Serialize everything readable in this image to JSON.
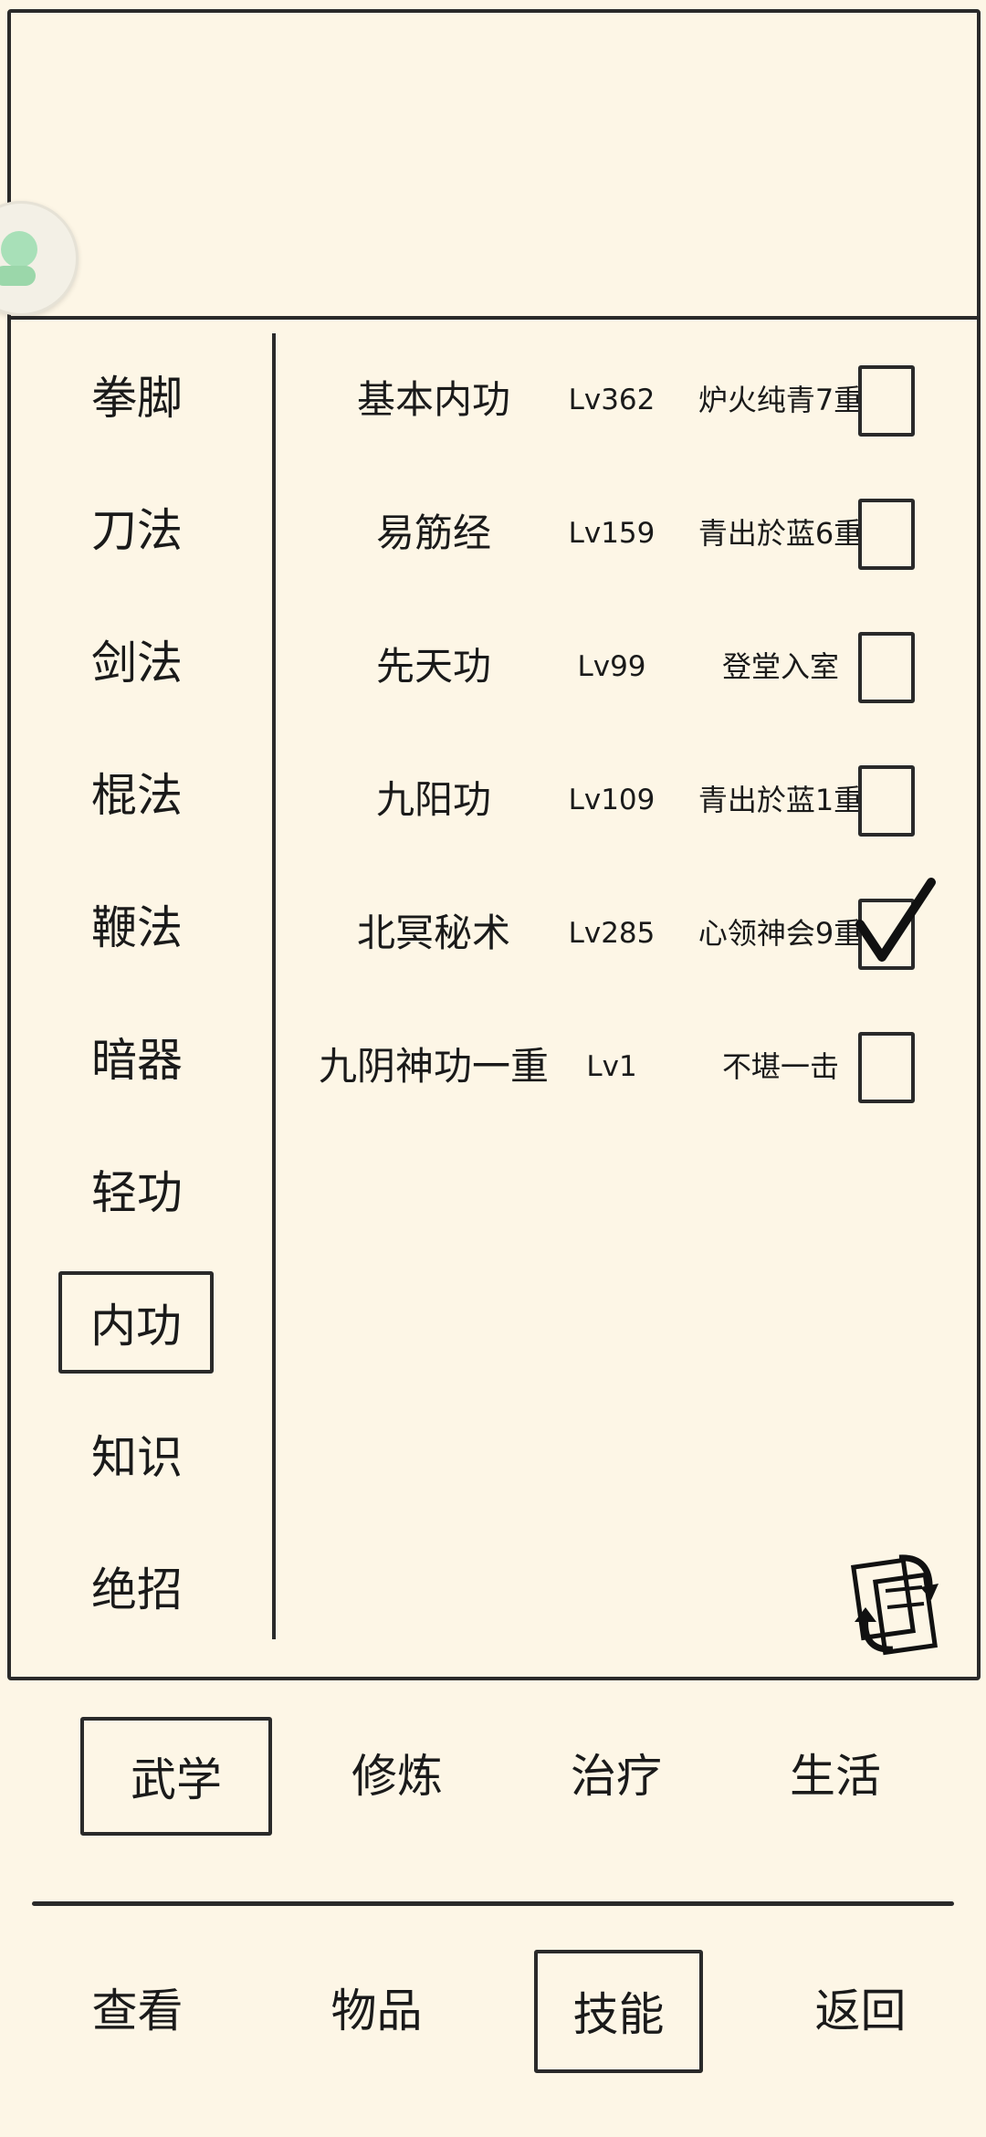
{
  "categories": [
    {
      "label": "拳脚",
      "selected": false
    },
    {
      "label": "刀法",
      "selected": false
    },
    {
      "label": "剑法",
      "selected": false
    },
    {
      "label": "棍法",
      "selected": false
    },
    {
      "label": "鞭法",
      "selected": false
    },
    {
      "label": "暗器",
      "selected": false
    },
    {
      "label": "轻功",
      "selected": false
    },
    {
      "label": "内功",
      "selected": true
    },
    {
      "label": "知识",
      "selected": false
    },
    {
      "label": "绝招",
      "selected": false
    }
  ],
  "skills": [
    {
      "name": "基本内功",
      "level": "Lv362",
      "tier": "炉火纯青7重",
      "checked": false
    },
    {
      "name": "易筋经",
      "level": "Lv159",
      "tier": "青出於蓝6重",
      "checked": false
    },
    {
      "name": "先天功",
      "level": "Lv99",
      "tier": "登堂入室",
      "checked": false
    },
    {
      "name": "九阳功",
      "level": "Lv109",
      "tier": "青出於蓝1重",
      "checked": false
    },
    {
      "name": "北冥秘术",
      "level": "Lv285",
      "tier": "心领神会9重",
      "checked": true
    },
    {
      "name": "九阴神功一重",
      "level": "Lv1",
      "tier": "不堪一击",
      "checked": false
    }
  ],
  "tabs": [
    {
      "label": "武学",
      "selected": true
    },
    {
      "label": "修炼",
      "selected": false
    },
    {
      "label": "治疗",
      "selected": false
    },
    {
      "label": "生活",
      "selected": false
    }
  ],
  "nav": [
    {
      "label": "查看",
      "selected": false
    },
    {
      "label": "物品",
      "selected": false
    },
    {
      "label": "技能",
      "selected": true
    },
    {
      "label": "返回",
      "selected": false
    }
  ],
  "icons": {
    "swap": "swap-icon",
    "floating_ball": "floating-assistant-icon"
  }
}
